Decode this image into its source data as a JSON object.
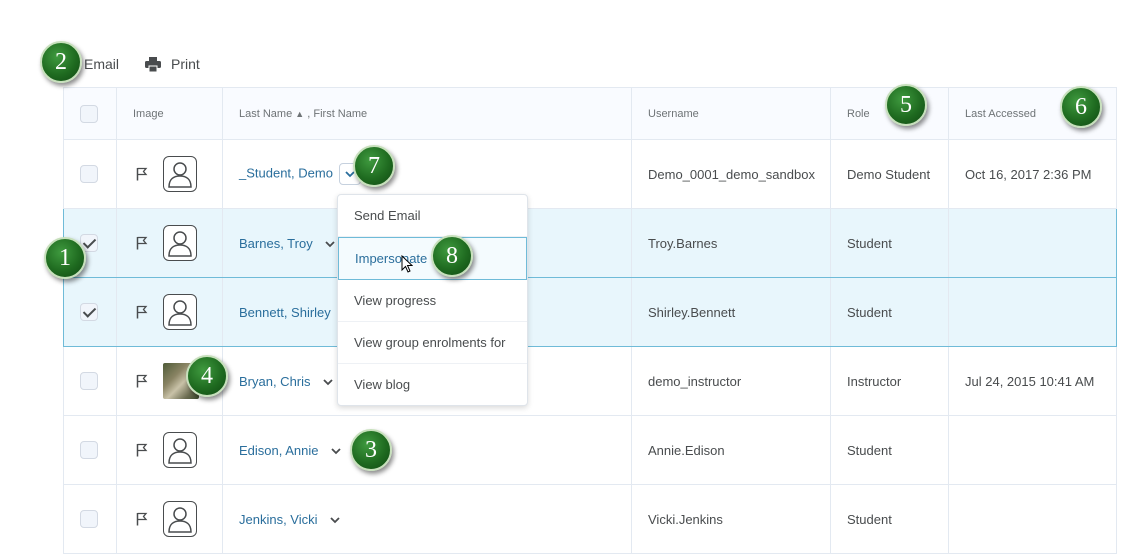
{
  "toolbar": {
    "email_label": "Email",
    "print_label": "Print"
  },
  "table": {
    "headers": {
      "image": "Image",
      "name_last": "Last Name",
      "name_first": ", First Name",
      "username": "Username",
      "role": "Role",
      "last_accessed": "Last Accessed"
    },
    "rows": [
      {
        "name": "_Student, Demo",
        "username": "Demo_0001_demo_sandbox",
        "role": "Demo Student",
        "last_accessed": "Oct 16, 2017 2:36 PM",
        "checked": false
      },
      {
        "name": "Barnes, Troy",
        "username": "Troy.Barnes",
        "role": "Student",
        "last_accessed": "",
        "checked": true
      },
      {
        "name": "Bennett, Shirley",
        "username": "Shirley.Bennett",
        "role": "Student",
        "last_accessed": "",
        "checked": true
      },
      {
        "name": "Bryan, Chris",
        "username": "demo_instructor",
        "role": "Instructor",
        "last_accessed": "Jul 24, 2015 10:41 AM",
        "checked": false
      },
      {
        "name": "Edison, Annie",
        "username": "Annie.Edison",
        "role": "Student",
        "last_accessed": "",
        "checked": false
      },
      {
        "name": "Jenkins, Vicki",
        "username": "Vicki.Jenkins",
        "role": "Student",
        "last_accessed": "",
        "checked": false
      }
    ]
  },
  "dropdown": {
    "items": [
      "Send Email",
      "Impersonate",
      "View progress",
      "View group enrolments for",
      "View blog"
    ],
    "active_index": 1
  },
  "callouts": [
    "1",
    "2",
    "3",
    "4",
    "5",
    "6",
    "7",
    "8"
  ],
  "colors": {
    "link": "#2a6e9c",
    "selected_row": "#e8f6fc",
    "selected_border": "#6fbbd8",
    "badge": "#1f6b20"
  }
}
